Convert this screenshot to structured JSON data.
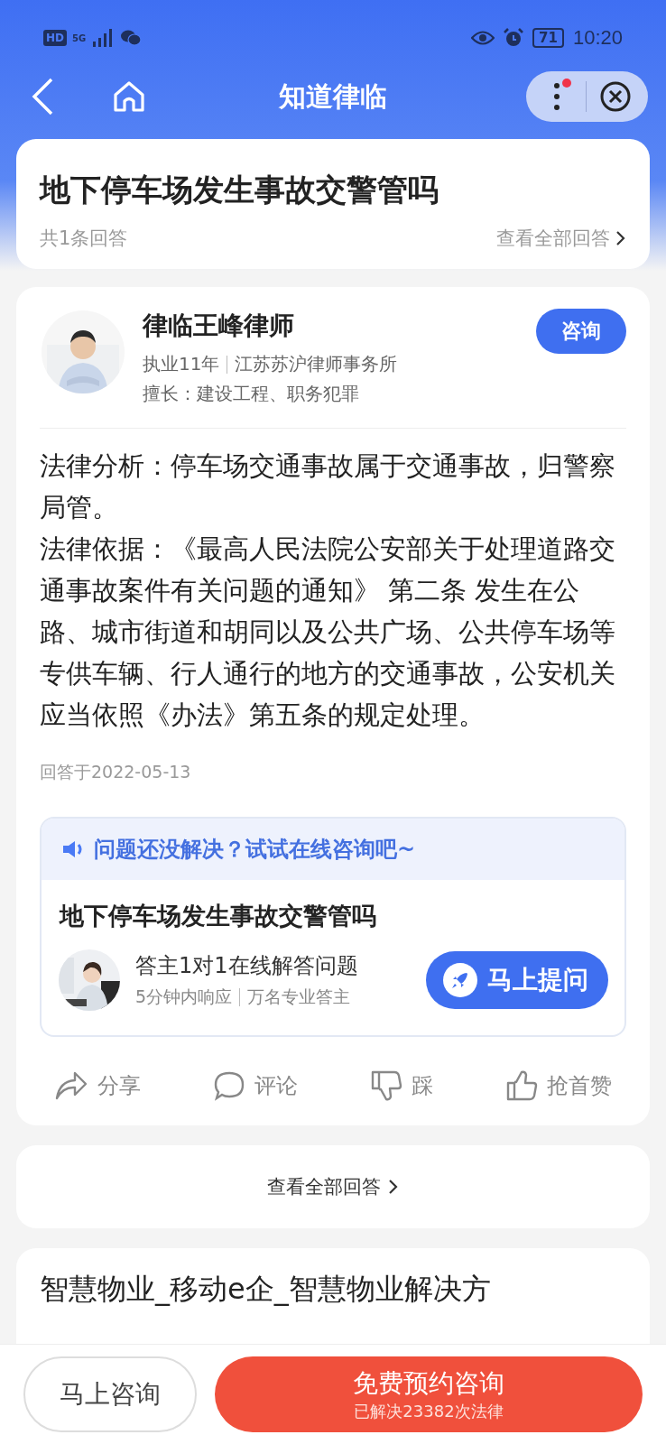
{
  "status_bar": {
    "left_icons": [
      "HD",
      "5G"
    ],
    "time": "10:20",
    "battery": "71"
  },
  "header": {
    "title": "知道律临",
    "menu_badge": true
  },
  "question": {
    "title": "地下停车场发生事故交警管吗",
    "answer_count": "共1条回答",
    "view_all": "查看全部回答"
  },
  "answer": {
    "lawyer_name": "律临王峰律师",
    "experience": "执业11年",
    "firm": "江苏苏沪律师事务所",
    "specialty": "擅长：建设工程、职务犯罪",
    "consult_button": "咨询",
    "paragraphs": [
      "法律分析：停车场交通事故属于交通事故，归警察局管。",
      "法律依据：《最高人民法院公安部关于处理道路交通事故案件有关问题的通知》 第二条 发生在公路、城市街道和胡同以及公共广场、公共停车场等专供车辆、行人通行的地方的交通事故，公安机关应当依照《办法》第五条的规定处理。"
    ],
    "date": "回答于2022-05-13"
  },
  "promo": {
    "banner": "问题还没解决？试试在线咨询吧~",
    "question": "地下停车场发生事故交警管吗",
    "line1": "答主1对1在线解答问题",
    "line2a": "5分钟内响应",
    "line2b": "万名专业答主",
    "ask_button": "马上提问"
  },
  "actions": [
    {
      "kind": "share",
      "label": "分享"
    },
    {
      "kind": "comment",
      "label": "评论"
    },
    {
      "kind": "dislike",
      "label": "踩"
    },
    {
      "kind": "like",
      "label": "抢首赞"
    }
  ],
  "view_all_answers": "查看全部回答",
  "next_card": {
    "title": "智慧物业_移动e企_智慧物业解决方"
  },
  "bottom_bar": {
    "consult_now": "马上咨询",
    "free_booking": "免费预约咨询",
    "solved": "已解决23382次法律"
  }
}
